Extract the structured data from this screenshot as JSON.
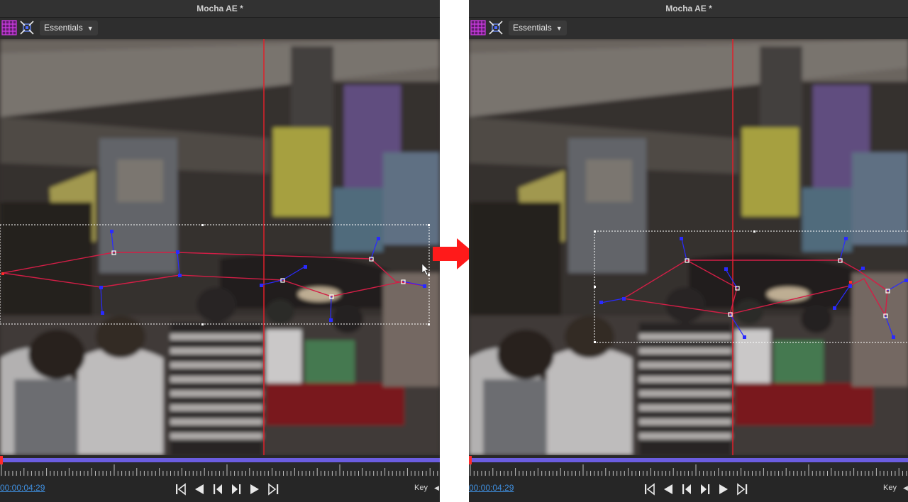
{
  "left_panel": {
    "window_title": "Mocha AE *",
    "workspace": {
      "label": "Essentials"
    },
    "timecode": "00:00:04:29",
    "key_label": "Key",
    "icons": {
      "grid": "grid-icon",
      "surface": "surface-icon",
      "caret": "chevron-down-icon"
    }
  },
  "right_panel": {
    "window_title": "Mocha AE *",
    "workspace": {
      "label": "Essentials"
    },
    "timecode": "00:00:04:29",
    "key_label": "Key",
    "icons": {
      "grid": "grid-icon",
      "surface": "surface-icon",
      "caret": "chevron-down-icon"
    }
  },
  "transport_icons": [
    "go-to-start-icon",
    "play-backward-icon",
    "step-backward-icon",
    "step-forward-icon",
    "play-forward-icon",
    "go-to-end-icon"
  ],
  "colors": {
    "accent": "#6b5de0",
    "spline": "#d21e46",
    "control_point": "#2a2aff",
    "playhead": "#ff2a2a",
    "timecode": "#3f8fdf",
    "arrow": "#ff1a1a",
    "grid_icon": "#c522d9"
  },
  "divider_arrow_icon": "right-arrow-icon"
}
